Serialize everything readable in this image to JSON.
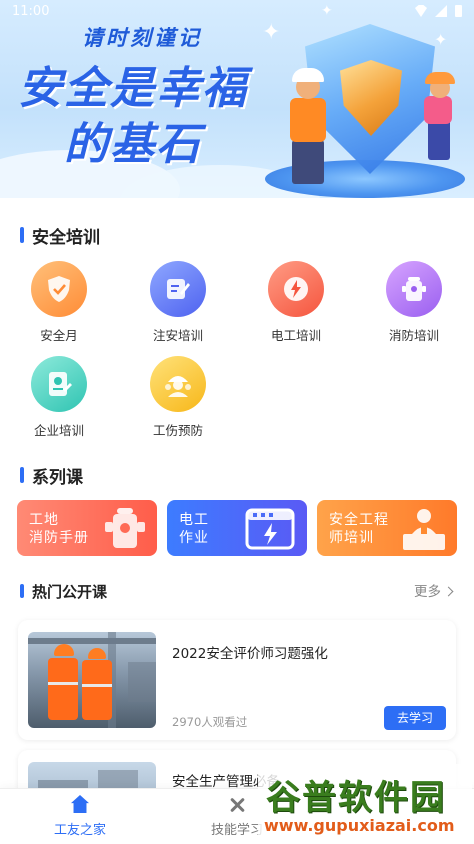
{
  "status_bar": {
    "time": "11:00"
  },
  "banner": {
    "subtitle": "请时刻谨记",
    "headline_line1": "安全是幸福",
    "headline_line2": "的基石"
  },
  "safety_training": {
    "title": "安全培训",
    "items": [
      {
        "label": "安全月",
        "icon": "shield-check-icon",
        "color": "#ff8c36"
      },
      {
        "label": "注安培训",
        "icon": "pencil-note-icon",
        "color": "#4e62f0"
      },
      {
        "label": "电工培训",
        "icon": "lightning-icon",
        "color": "#f5553e"
      },
      {
        "label": "消防培训",
        "icon": "fire-hydrant-icon",
        "color": "#9a5ff0"
      },
      {
        "label": "企业培训",
        "icon": "certificate-icon",
        "color": "#2fc4b2"
      },
      {
        "label": "工伤预防",
        "icon": "helmet-workers-icon",
        "color": "#f7b719"
      }
    ]
  },
  "series_courses": {
    "title": "系列课",
    "cards": [
      {
        "line1": "工地",
        "line2": "消防手册",
        "icon": "fire-hydrant-icon"
      },
      {
        "line1": "电工",
        "line2": "作业",
        "icon": "electric-box-icon"
      },
      {
        "line1": "安全工程",
        "line2": "师培训",
        "icon": "lecturer-icon"
      }
    ]
  },
  "open_courses": {
    "title": "热门公开课",
    "more_label": "更多",
    "courses": [
      {
        "title": "2022安全评价师习题强化",
        "views": "2970人观看过",
        "button": "去学习"
      },
      {
        "title": "安全生产管理必备"
      }
    ]
  },
  "bottom_nav": {
    "items": [
      {
        "label": "工友之家",
        "icon": "home-icon",
        "active": true
      },
      {
        "label": "技能学习",
        "icon": "tools-icon",
        "active": false
      }
    ]
  },
  "watermark": {
    "brand": "谷普软件园",
    "url": "www.gupuxiazai.com"
  },
  "theme": {
    "accent": "#2d6ef5"
  }
}
